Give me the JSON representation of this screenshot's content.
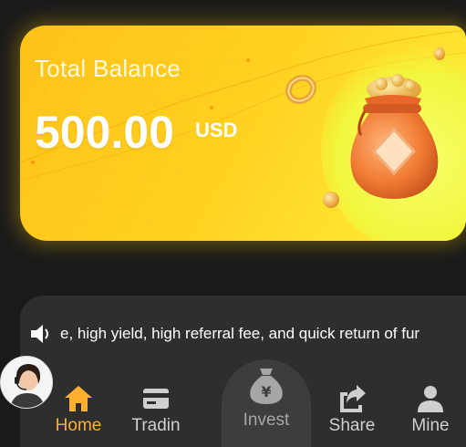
{
  "balance": {
    "label": "Total Balance",
    "amount": "500.00",
    "currency": "USD"
  },
  "notice": {
    "icon": "speaker-icon",
    "text": "e, high yield, high referral fee, and quick return of fur"
  },
  "nav": {
    "items": [
      {
        "label": "Home",
        "icon": "home-icon",
        "active": true
      },
      {
        "label": "Tradin",
        "icon": "trading-card-icon",
        "active": false
      },
      {
        "label": "Invest",
        "icon": "money-bag-icon",
        "active": false
      },
      {
        "label": "Share",
        "icon": "share-icon",
        "active": false
      },
      {
        "label": "Mine",
        "icon": "user-icon",
        "active": false
      }
    ]
  },
  "colors": {
    "background": "#1a1a1a",
    "card_yellow": "#ffc21a",
    "nav_background": "#2e2e2e",
    "active_accent": "#ffb02e",
    "inactive_label": "#cfcfcf"
  }
}
